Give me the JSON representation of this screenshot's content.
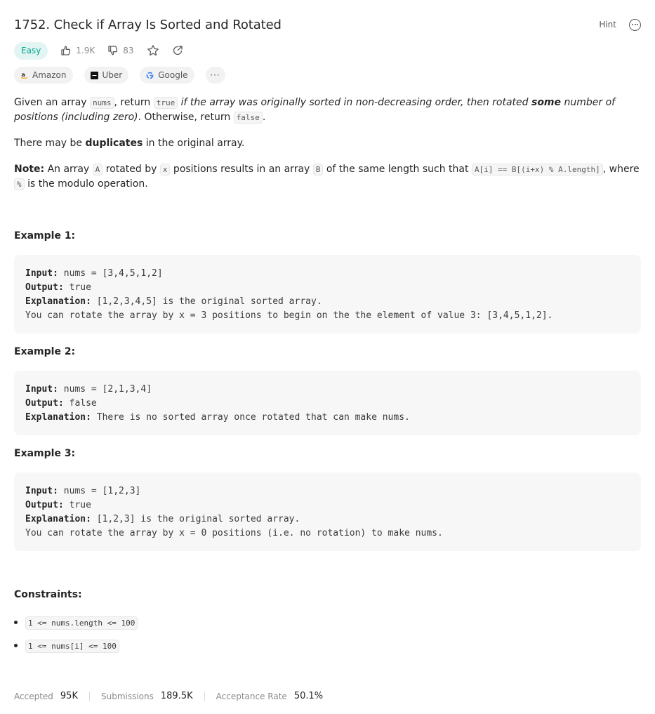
{
  "problem": {
    "title": "1752. Check if Array Is Sorted and Rotated",
    "hint_label": "Hint",
    "difficulty": "Easy",
    "likes": "1.9K",
    "dislikes": "83"
  },
  "tags": [
    {
      "label": "Amazon"
    },
    {
      "label": "Uber"
    },
    {
      "label": "Google"
    }
  ],
  "tags_more_label": "···",
  "description": {
    "p1": {
      "t1": "Given an array ",
      "c1": "nums",
      "t2": ", return ",
      "c2": "true",
      "t3": " ",
      "i1": "if the array was originally sorted in non-decreasing order, then rotated ",
      "b1": "some",
      "i2": " number of positions (including zero)",
      "t4": ". Otherwise, return ",
      "c3": "false",
      "t5": "."
    },
    "p2": {
      "t1": "There may be ",
      "b1": "duplicates",
      "t2": " in the original array."
    },
    "p3": {
      "b1": "Note:",
      "t1": " An array ",
      "c1": "A",
      "t2": " rotated by ",
      "c2": "x",
      "t3": " positions results in an array ",
      "c3": "B",
      "t4": " of the same length such that ",
      "c4": "A[i] == B[(i+x) % A.length]",
      "t5": ", where ",
      "c5": "%",
      "t6": " is the modulo operation."
    }
  },
  "examples": [
    {
      "title": "Example 1:",
      "input_label": "Input:",
      "input": " nums = [3,4,5,1,2]",
      "output_label": "Output:",
      "output": " true",
      "explanation_label": "Explanation:",
      "explanation": " [1,2,3,4,5] is the original sorted array.",
      "explanation_cont": "You can rotate the array by x = 3 positions to begin on the the element of value 3: [3,4,5,1,2]."
    },
    {
      "title": "Example 2:",
      "input_label": "Input:",
      "input": " nums = [2,1,3,4]",
      "output_label": "Output:",
      "output": " false",
      "explanation_label": "Explanation:",
      "explanation": " There is no sorted array once rotated that can make nums."
    },
    {
      "title": "Example 3:",
      "input_label": "Input:",
      "input": " nums = [1,2,3]",
      "output_label": "Output:",
      "output": " true",
      "explanation_label": "Explanation:",
      "explanation": " [1,2,3] is the original sorted array.",
      "explanation_cont": "You can rotate the array by x = 0 positions (i.e. no rotation) to make nums."
    }
  ],
  "constraints": {
    "title": "Constraints:",
    "items": [
      "1 <= nums.length <= 100",
      "1 <= nums[i] <= 100"
    ]
  },
  "footer": {
    "accepted_label": "Accepted",
    "accepted_value": "95K",
    "submissions_label": "Submissions",
    "submissions_value": "189.5K",
    "rate_label": "Acceptance Rate",
    "rate_value": "50.1%"
  },
  "colors": {
    "easy": "#00a88e",
    "easy_bg": "#e3f5f2",
    "amazon": "#ff9900",
    "google_blue": "#4285f4"
  },
  "icons": [
    "more-circle-icon",
    "thumbs-up-icon",
    "thumbs-down-icon",
    "star-icon",
    "share-icon",
    "amazon-logo-icon",
    "uber-logo-icon",
    "google-logo-icon"
  ]
}
